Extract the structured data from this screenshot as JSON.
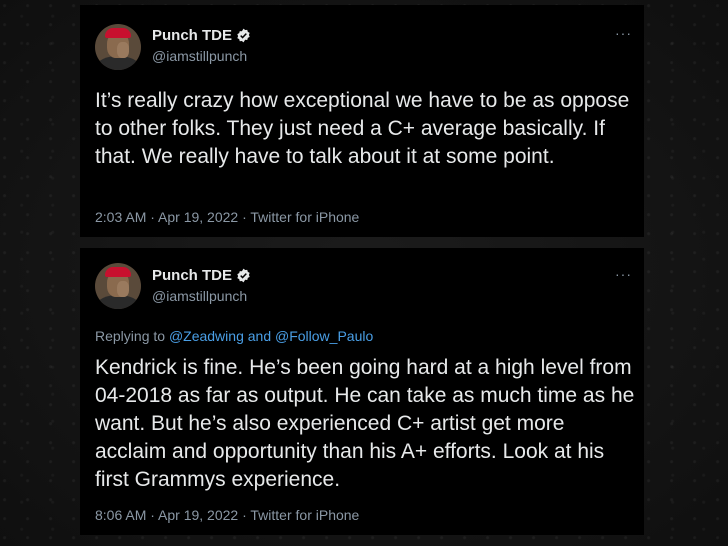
{
  "tweets": [
    {
      "display_name": "Punch TDE",
      "handle": "@iamstillpunch",
      "more": "···",
      "text": "It’s really crazy how exceptional we have to be as oppose to other folks. They just need a C+ average basically. If that. We really have to talk about it at some point.",
      "meta": "2:03 AM · Apr 19, 2022 · Twitter for iPhone"
    },
    {
      "display_name": "Punch TDE",
      "handle": "@iamstillpunch",
      "more": "···",
      "replying_prefix": "Replying to ",
      "replying_to": "@Zeadwing and @Follow_Paulo",
      "text": "Kendrick is fine. He’s been going hard at a high level from 04-2018 as far as output. He can take as much time as he want.  But he’s also experienced C+ artist get more acclaim and opportunity than his A+ efforts. Look at his first Grammys experience.",
      "meta": "8:06 AM · Apr 19, 2022 · Twitter for iPhone"
    }
  ],
  "colors": {
    "card_bg": "#000000",
    "text": "#e7e9ea",
    "secondary": "#8b98a5",
    "mention": "#4a9fe6"
  },
  "icons": [
    "avatar",
    "verified-badge-icon",
    "more-options-icon"
  ]
}
